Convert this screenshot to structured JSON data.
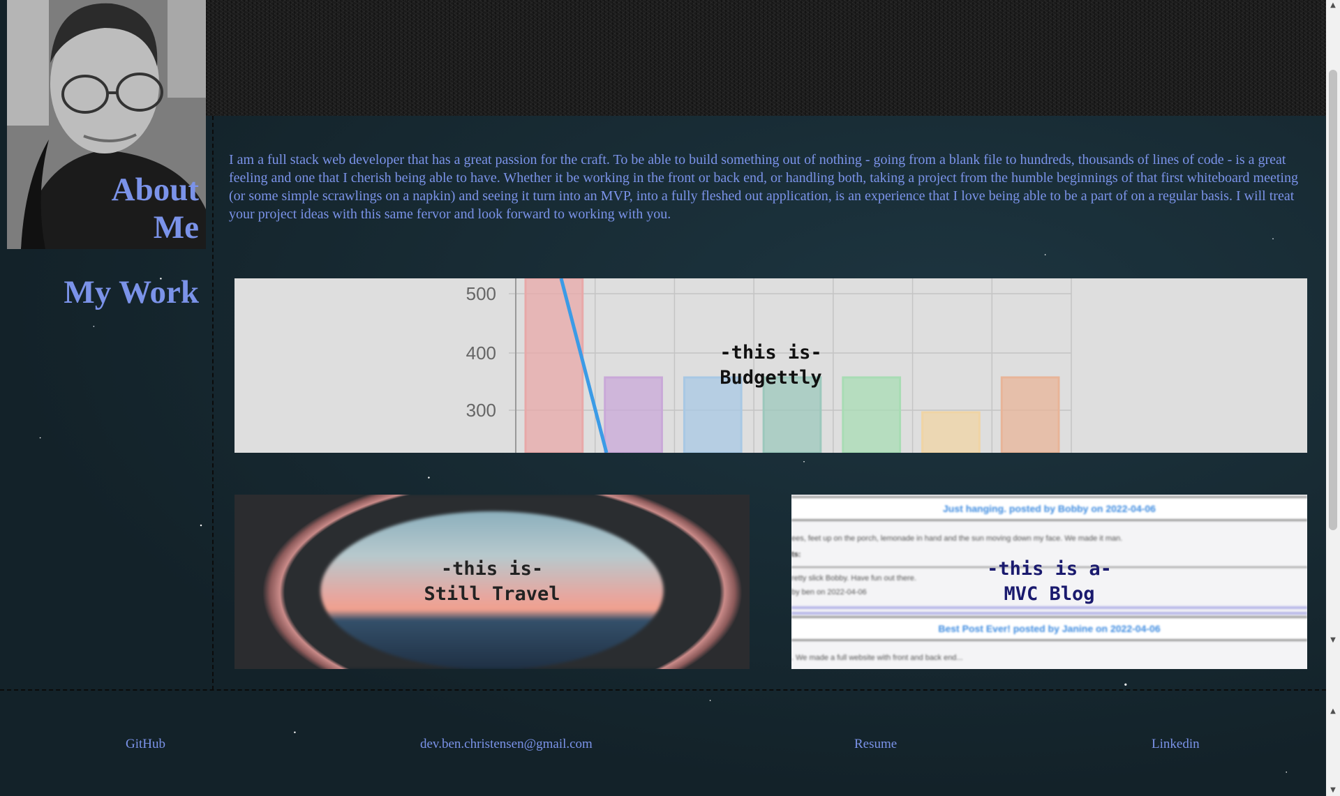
{
  "sidebar": {
    "about_label": "About Me",
    "work_label": "My Work"
  },
  "about": {
    "paragraph": "I am a full stack web developer that has a great passion for the craft. To be able to build something out of nothing - going from a blank file to hundreds, thousands of lines of code - is a great feeling and one that I cherish being able to have. Whether it be working in the front or back end, or handling both, taking a project from the humble beginnings of that first whiteboard meeting (or some simple scrawlings on a napkin) and seeing it turn into an MVP, into a fully fleshed out application, is an experience that I love being able to be a part of on a regular basis. I will treat your project ideas with this same fervor and look forward to working with you."
  },
  "projects": [
    {
      "prefix": "-this is-",
      "name": "Budgettly"
    },
    {
      "prefix": "-this is-",
      "name": "Still Travel"
    },
    {
      "prefix": "-this is a-",
      "name": "MVC Blog"
    }
  ],
  "budget_preview": {
    "tick_labels": [
      "500",
      "400",
      "300"
    ],
    "bar_colors": [
      "#e8a8a8",
      "#c9a8d8",
      "#a8c8e4",
      "#9cc8bc",
      "#a8dcb4",
      "#f0d4a4",
      "#e8b498"
    ]
  },
  "blog_preview": {
    "post1_title": "Just hanging. posted by Bobby on 2022-04-06",
    "post1_body": "ees, feet up on the porch, lemonade in hand and the sun moving down my face. We made it man.",
    "post1_comment_label": "ts:",
    "post1_comment": "retty slick Bobby. Have fun out there.",
    "post1_comment_meta": "by ben on 2022-04-06",
    "post2_title": "Best Post Ever! posted by Janine on 2022-04-06",
    "post2_body": ". We made a full website with front and back end..."
  },
  "footer": {
    "github": "GitHub",
    "email": "dev.ben.christensen@gmail.com",
    "resume": "Resume",
    "linkedin": "Linkedin"
  },
  "colors": {
    "accent_text": "#7b93e9",
    "background": "#152630",
    "budget_caption": "#111111",
    "travel_caption": "#222222",
    "blog_caption": "#1a1a6e"
  }
}
